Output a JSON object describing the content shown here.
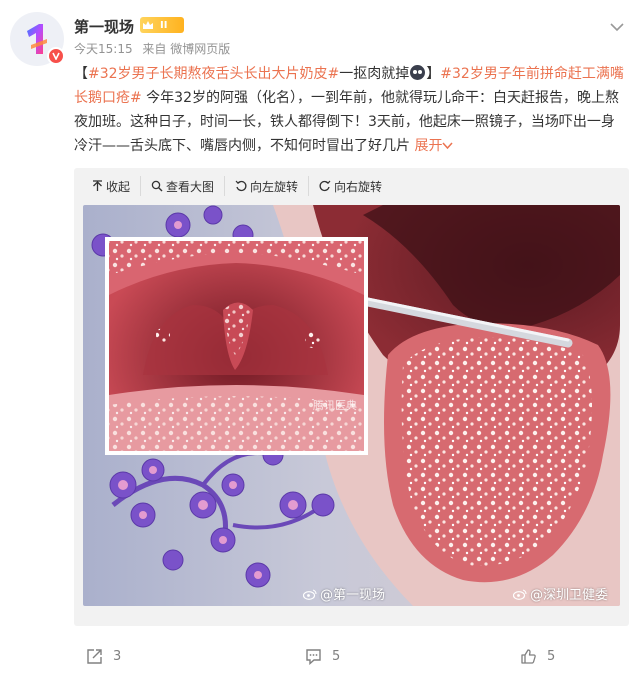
{
  "author": {
    "name": "第一现场",
    "level_badge": "II",
    "avatar_icon": "number-one-logo",
    "verified_icon": "verified-v-icon"
  },
  "meta": {
    "time": "今天15:15",
    "source": "来自 微博网页版"
  },
  "post": {
    "bracket_open": "【",
    "tag1": "#32岁男子长期熬夜舌头长出大片奶皮#",
    "text1": "一抠肉就掉",
    "bracket_close": "】",
    "tag2": "#32岁男子年前拼命赶工满嘴长鹅口疮#",
    "body": " 今年32岁的阿强（化名），一到年前，他就得玩儿命干：白天赶报告，晚上熬夜加班。这种日子，时间一长，铁人都得倒下！3天前，他起床一照镜子，当场吓出一身冷汗——舌头底下、嘴唇内侧，不知何时冒出了好几片",
    "expand_label": "展开"
  },
  "media_toolbar": {
    "collapse": "收起",
    "view_large": "查看大图",
    "rotate_left": "向左旋转",
    "rotate_right": "向右旋转"
  },
  "image": {
    "watermark_left": "@第一现场",
    "watermark_right": "@深圳卫健委",
    "inset_watermark": "腾讯医典"
  },
  "actions": {
    "share_count": "3",
    "comment_count": "5",
    "like_count": "5"
  },
  "colors": {
    "accent": "#eb7350",
    "muted": "#939393",
    "badge_gold": "#ffb21f",
    "verified_red": "#f7504b"
  }
}
